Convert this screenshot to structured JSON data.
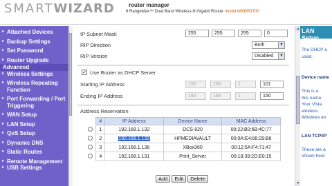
{
  "header": {
    "logo_smart": "SMART",
    "logo_wizard": "WIZARD",
    "subtitle": "router manager",
    "product": "6 RangeMax™ Dual Band Wireless-N Gigabit Router",
    "model": "model WNDR3700"
  },
  "sidebar": {
    "items": [
      {
        "label": "Attached Devices"
      },
      {
        "label": "Backup Settings"
      },
      {
        "label": "Set Password"
      },
      {
        "label": "Router Upgrade"
      }
    ],
    "group": "Advanced",
    "advanced_items": [
      {
        "label": "Wireless Settings"
      },
      {
        "label": "Wireless Repeating Function"
      },
      {
        "label": "Port Forwarding / Port Triggering"
      },
      {
        "label": "WAN Setup"
      },
      {
        "label": "LAN Setup"
      },
      {
        "label": "QoS Setup"
      },
      {
        "label": "Dynamic DNS"
      },
      {
        "label": "Static Routes"
      },
      {
        "label": "Remote Management"
      },
      {
        "label": "USB Settings"
      }
    ]
  },
  "form": {
    "subnet_label": "IP Subnet Mask",
    "subnet": [
      "255",
      "255",
      "255",
      "0"
    ],
    "rip_direction_label": "RIP Direction",
    "rip_direction_value": "Both",
    "rip_version_label": "RIP Version",
    "rip_version_value": "Disabled",
    "dhcp_checkbox_label": "Use Router as DHCP Server",
    "start_ip_label": "Starting IP Address",
    "start_ip": [
      "192",
      "168",
      "1",
      "101"
    ],
    "end_ip_label": "Ending IP Address",
    "end_ip": [
      "192",
      "168",
      "1",
      "150"
    ]
  },
  "reservation": {
    "title": "Address Reservation",
    "columns": [
      "#",
      "IP Address",
      "Device Name",
      "MAC Address"
    ],
    "rows": [
      {
        "num": "1",
        "ip": "192.168.1.132",
        "name": "DCS-920",
        "mac": "00:22:B0:6B:4C:77"
      },
      {
        "num": "2",
        "ip": "192.168.1.133",
        "name": "HPMEDIAVAULT",
        "mac": "00:0A:E4:88:29:B6"
      },
      {
        "num": "3",
        "ip": "192.168.1.136",
        "name": "XBox360",
        "mac": "00:12:5A:F4:71:47"
      },
      {
        "num": "4",
        "ip": "192.168.1.131",
        "name": "Print_Server",
        "mac": "00:18:39:2D:E0:15"
      }
    ],
    "buttons": {
      "add": "Add",
      "edit": "Edit",
      "delete": "Delete"
    }
  },
  "help": {
    "title": "LAN Setup",
    "line1": "The DHCP a",
    "line2": "used.",
    "sub1": "Device name",
    "line3": "This is a",
    "line4": "this name",
    "line5": "Your Vista",
    "line6": "wireless",
    "line7": "Windows an",
    "sub2": "LAN TCP/IP",
    "line8": "These are a",
    "line9": "shown here"
  }
}
